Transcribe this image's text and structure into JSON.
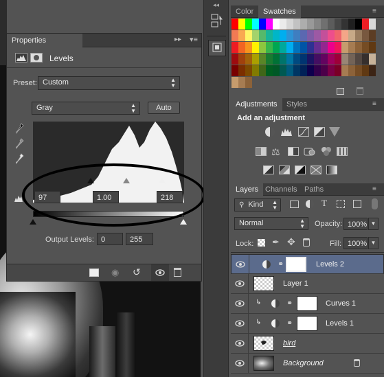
{
  "properties": {
    "panel_tab": "Properties",
    "title": "Levels",
    "preset_label": "Preset:",
    "preset_value": "Custom",
    "channel_value": "Gray",
    "auto_button": "Auto",
    "input_black": "97",
    "input_gamma": "1.00",
    "input_white": "218",
    "output_label": "Output Levels:",
    "output_black": "0",
    "output_white": "255"
  },
  "swatches_panel": {
    "tabs": [
      "Color",
      "Swatches"
    ],
    "active_tab": "Swatches",
    "rows": [
      [
        "#ff0000",
        "#ffff00",
        "#00ff00",
        "#00ffff",
        "#0000ff",
        "#ff00ff",
        "#ffffff",
        "#ebebeb",
        "#d6d6d6",
        "#c2c2c2",
        "#adadad",
        "#999999",
        "#858585",
        "#707070",
        "#5c5c5c",
        "#474747",
        "#333333",
        "#1f1f1f",
        "#000000",
        "#ee1d24",
        "#d8d8d8"
      ],
      [
        "#f27a54",
        "#f9a851",
        "#fff568",
        "#a4d36b",
        "#55b96b",
        "#16b49a",
        "#00b6c7",
        "#00aeef",
        "#2e93d5",
        "#3f7ec0",
        "#5b68b1",
        "#7f5ba6",
        "#9d59a4",
        "#c3509a",
        "#ee4e8c",
        "#f0646c",
        "#f4a688",
        "#c7a987",
        "#997c5e",
        "#78583f",
        "#5c3d24"
      ],
      [
        "#ed1c24",
        "#f26522",
        "#f7941d",
        "#fff200",
        "#8dc63f",
        "#39b54a",
        "#00a651",
        "#00a99d",
        "#00aeef",
        "#0072bc",
        "#0054a6",
        "#2e3192",
        "#662d91",
        "#92278f",
        "#ec008c",
        "#ed145b",
        "#c69c6d",
        "#a67c52",
        "#8c6239",
        "#754c24",
        "#603913"
      ],
      [
        "#9e0b0f",
        "#a0410d",
        "#a3620a",
        "#aba000",
        "#598527",
        "#197b30",
        "#007236",
        "#00746b",
        "#0076a3",
        "#004a80",
        "#003471",
        "#1b1464",
        "#440e62",
        "#630460",
        "#9e005d",
        "#9e0039",
        "#998675",
        "#736357",
        "#534741",
        "#362f2d",
        "#c7b299"
      ],
      [
        "#790000",
        "#7b2e00",
        "#7d4900",
        "#827b00",
        "#406618",
        "#005e20",
        "#005826",
        "#005952",
        "#005b7f",
        "#003663",
        "#002157",
        "#0d004c",
        "#32004b",
        "#4b0049",
        "#7b0046",
        "#7a0026",
        "#a67c52",
        "#8c6239",
        "#754c24",
        "#603913",
        "#3c2415"
      ],
      [
        "#c69c6d",
        "#a67c52",
        "#8c6239"
      ]
    ]
  },
  "adjustments_panel": {
    "tabs": [
      "Adjustments",
      "Styles"
    ],
    "active_tab": "Adjustments",
    "heading": "Add an adjustment",
    "row1": [
      "brightness-contrast-icon",
      "levels-icon",
      "curves-icon",
      "exposure-icon",
      "vibrance-icon"
    ],
    "row2": [
      "hue-saturation-icon",
      "color-balance-icon",
      "black-white-icon",
      "photo-filter-icon",
      "channel-mixer-icon",
      "color-lookup-icon"
    ],
    "row3": [
      "invert-icon",
      "posterize-icon",
      "threshold-icon",
      "selective-color-icon",
      "gradient-map-icon"
    ]
  },
  "layers_panel": {
    "tabs": [
      "Layers",
      "Channels",
      "Paths"
    ],
    "active_tab": "Layers",
    "kind_label": "Kind",
    "blend_mode": "Normal",
    "opacity_label": "Opacity:",
    "opacity_value": "100%",
    "lock_label": "Lock:",
    "fill_label": "Fill:",
    "fill_value": "100%",
    "layers": [
      {
        "name": "Levels 2",
        "selected": true,
        "clipped": false
      },
      {
        "name": "Layer 1",
        "selected": false,
        "clipped": false
      },
      {
        "name": "Curves 1",
        "selected": false,
        "clipped": true
      },
      {
        "name": "Levels 1",
        "selected": false,
        "clipped": true
      },
      {
        "name": "bird",
        "selected": false,
        "clipped": false
      },
      {
        "name": "Background",
        "selected": false,
        "clipped": false
      }
    ]
  }
}
